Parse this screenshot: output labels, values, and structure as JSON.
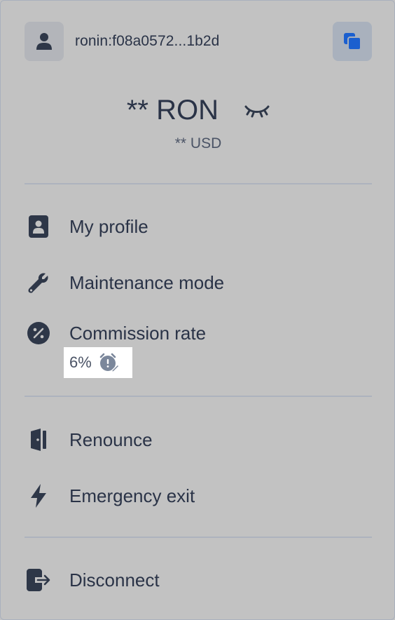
{
  "header": {
    "address": "ronin:f08a0572...1b2d",
    "avatar_icon": "user-icon",
    "copy_icon": "copy-icon",
    "accent": "#1b5fcf"
  },
  "balance": {
    "amount": "** RON",
    "usd": "** USD",
    "toggle_icon": "eye-closed-icon"
  },
  "menu": {
    "profile": {
      "label": "My profile",
      "icon": "id-badge-icon"
    },
    "maintenance": {
      "label": "Maintenance mode",
      "icon": "wrench-icon"
    },
    "commission": {
      "label": "Commission rate",
      "icon": "percent-icon",
      "value": "6%",
      "value_icon": "alarm-edit-icon"
    },
    "renounce": {
      "label": "Renounce",
      "icon": "door-icon"
    },
    "emergency": {
      "label": "Emergency exit",
      "icon": "lightning-icon"
    },
    "disconnect": {
      "label": "Disconnect",
      "icon": "logout-icon"
    }
  }
}
